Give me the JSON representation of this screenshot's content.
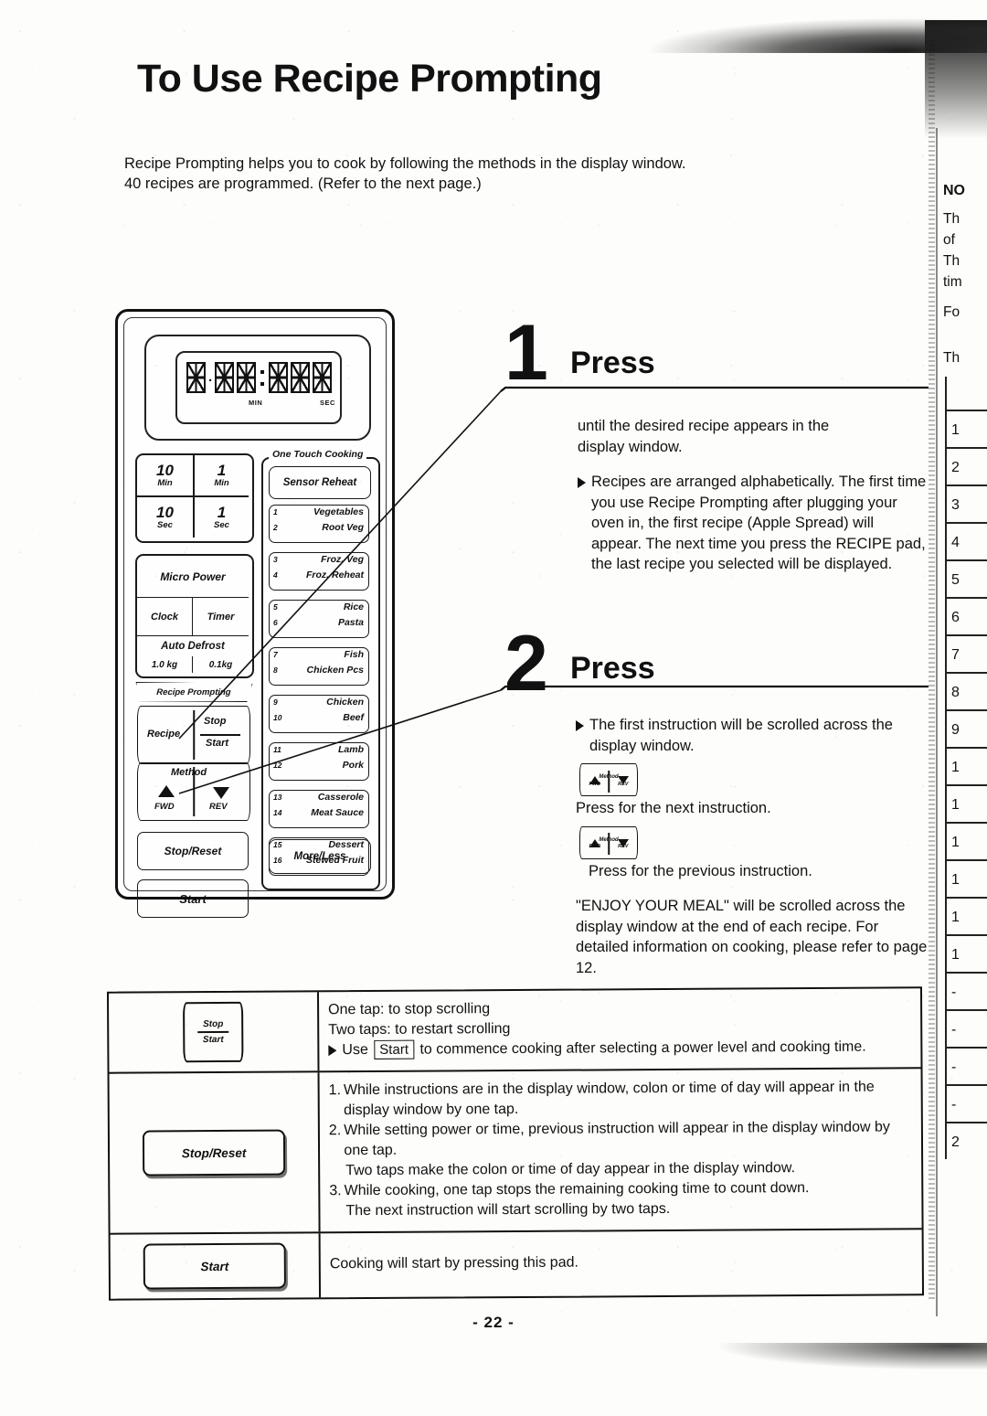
{
  "page": {
    "title": "To Use Recipe Prompting",
    "intro_line1": "Recipe Prompting helps you to cook by following the methods in the display window.",
    "intro_line2": "40 recipes are programmed. (Refer to the next page.)",
    "page_number": "- 22 -"
  },
  "control_panel": {
    "display": {
      "min_label": "MIN",
      "sec_label": "SEC",
      "digit_count": 6
    },
    "time_pads": [
      {
        "value": "10",
        "unit": "Min"
      },
      {
        "value": "1",
        "unit": "Min"
      },
      {
        "value": "10",
        "unit": "Sec"
      },
      {
        "value": "1",
        "unit": "Sec"
      }
    ],
    "micro_power": "Micro Power",
    "clock": "Clock",
    "timer": "Timer",
    "auto_defrost": "Auto Defrost",
    "defrost_kg_1": "1.0 kg",
    "defrost_kg_2": "0.1kg",
    "recipe_prompting_banner": "Recipe Prompting",
    "recipe": "Recipe",
    "stop": "Stop",
    "start": "Start",
    "method": "Method",
    "fwd": "FWD",
    "rev": "REV",
    "stop_reset": "Stop/Reset",
    "start_pad": "Start",
    "one_touch": {
      "title": "One Touch Cooking",
      "sensor_reheat": "Sensor Reheat",
      "more_less": "More/Less",
      "groups": [
        [
          {
            "num": "1",
            "label": "Vegetables"
          },
          {
            "num": "2",
            "label": "Root Veg"
          }
        ],
        [
          {
            "num": "3",
            "label": "Froz. Veg"
          },
          {
            "num": "4",
            "label": "Froz. Reheat"
          }
        ],
        [
          {
            "num": "5",
            "label": "Rice"
          },
          {
            "num": "6",
            "label": "Pasta"
          }
        ],
        [
          {
            "num": "7",
            "label": "Fish"
          },
          {
            "num": "8",
            "label": "Chicken Pcs"
          }
        ],
        [
          {
            "num": "9",
            "label": "Chicken"
          },
          {
            "num": "10",
            "label": "Beef"
          }
        ],
        [
          {
            "num": "11",
            "label": "Lamb"
          },
          {
            "num": "12",
            "label": "Pork"
          }
        ],
        [
          {
            "num": "13",
            "label": "Casserole"
          },
          {
            "num": "14",
            "label": "Meat Sauce"
          }
        ],
        [
          {
            "num": "15",
            "label": "Dessert"
          },
          {
            "num": "16",
            "label": "Stewed Fruit"
          }
        ]
      ]
    }
  },
  "step1": {
    "number": "1",
    "word": "Press",
    "lead1": "until the desired recipe appears in the",
    "lead2": "display window.",
    "bullet": "Recipes are arranged alphabetically. The first time you use Recipe Prompting after plugging your oven in, the first recipe (Apple Spread) will appear. The next time you press the RECIPE pad, the last recipe you selected will be displayed."
  },
  "step2": {
    "number": "2",
    "word": "Press",
    "bullet": "The first instruction will be scrolled across the display window.",
    "pad_method": "Method",
    "pad_fwd": "FWD",
    "pad_rev": "REV",
    "next_caption": "Press for the next instruction.",
    "prev_caption": "Press for the previous instruction.",
    "closing": "\"ENJOY YOUR MEAL\" will be scrolled across the display window at the end of each recipe. For detailed information on cooking, please refer to page 12."
  },
  "table": {
    "rows": [
      {
        "icon_type": "stop-start-pad",
        "icon_top": "Stop",
        "icon_bottom": "Start",
        "lines": [
          "One tap:   to stop scrolling",
          "Two taps:  to restart scrolling"
        ],
        "bullet_pre": "Use",
        "bullet_key": "Start",
        "bullet_post": "to commence cooking after selecting a power level and cooking time."
      },
      {
        "icon_type": "rect-pad",
        "icon_label": "Stop/Reset",
        "numbered": [
          {
            "n": "1.",
            "text": "While instructions are in the display window, colon or time of day will appear in the display window by one tap.",
            "extra": ""
          },
          {
            "n": "2.",
            "text": "While setting power or time, previous instruction will appear in the display window by one tap.",
            "extra": "Two taps make the colon or time of day appear in the display window."
          },
          {
            "n": "3.",
            "text": "While cooking, one tap stops the remaining cooking time to count down.",
            "extra": "The next instruction will start scrolling by two taps."
          }
        ]
      },
      {
        "icon_type": "rect-pad",
        "icon_label": "Start",
        "lines": [
          "Cooking will start by pressing this pad."
        ]
      }
    ]
  },
  "right_page": {
    "note_label": "NO",
    "lines": [
      "Th",
      "of ",
      "Th",
      "tim",
      "Fo"
    ],
    "second_th": "Th",
    "table_rows": [
      "",
      "1",
      "2",
      "3",
      "4",
      "5",
      "6",
      "7",
      "8",
      "9",
      "1",
      "1",
      "1",
      "1",
      "1",
      "1",
      "-",
      "-",
      "-",
      "-",
      "2"
    ]
  }
}
